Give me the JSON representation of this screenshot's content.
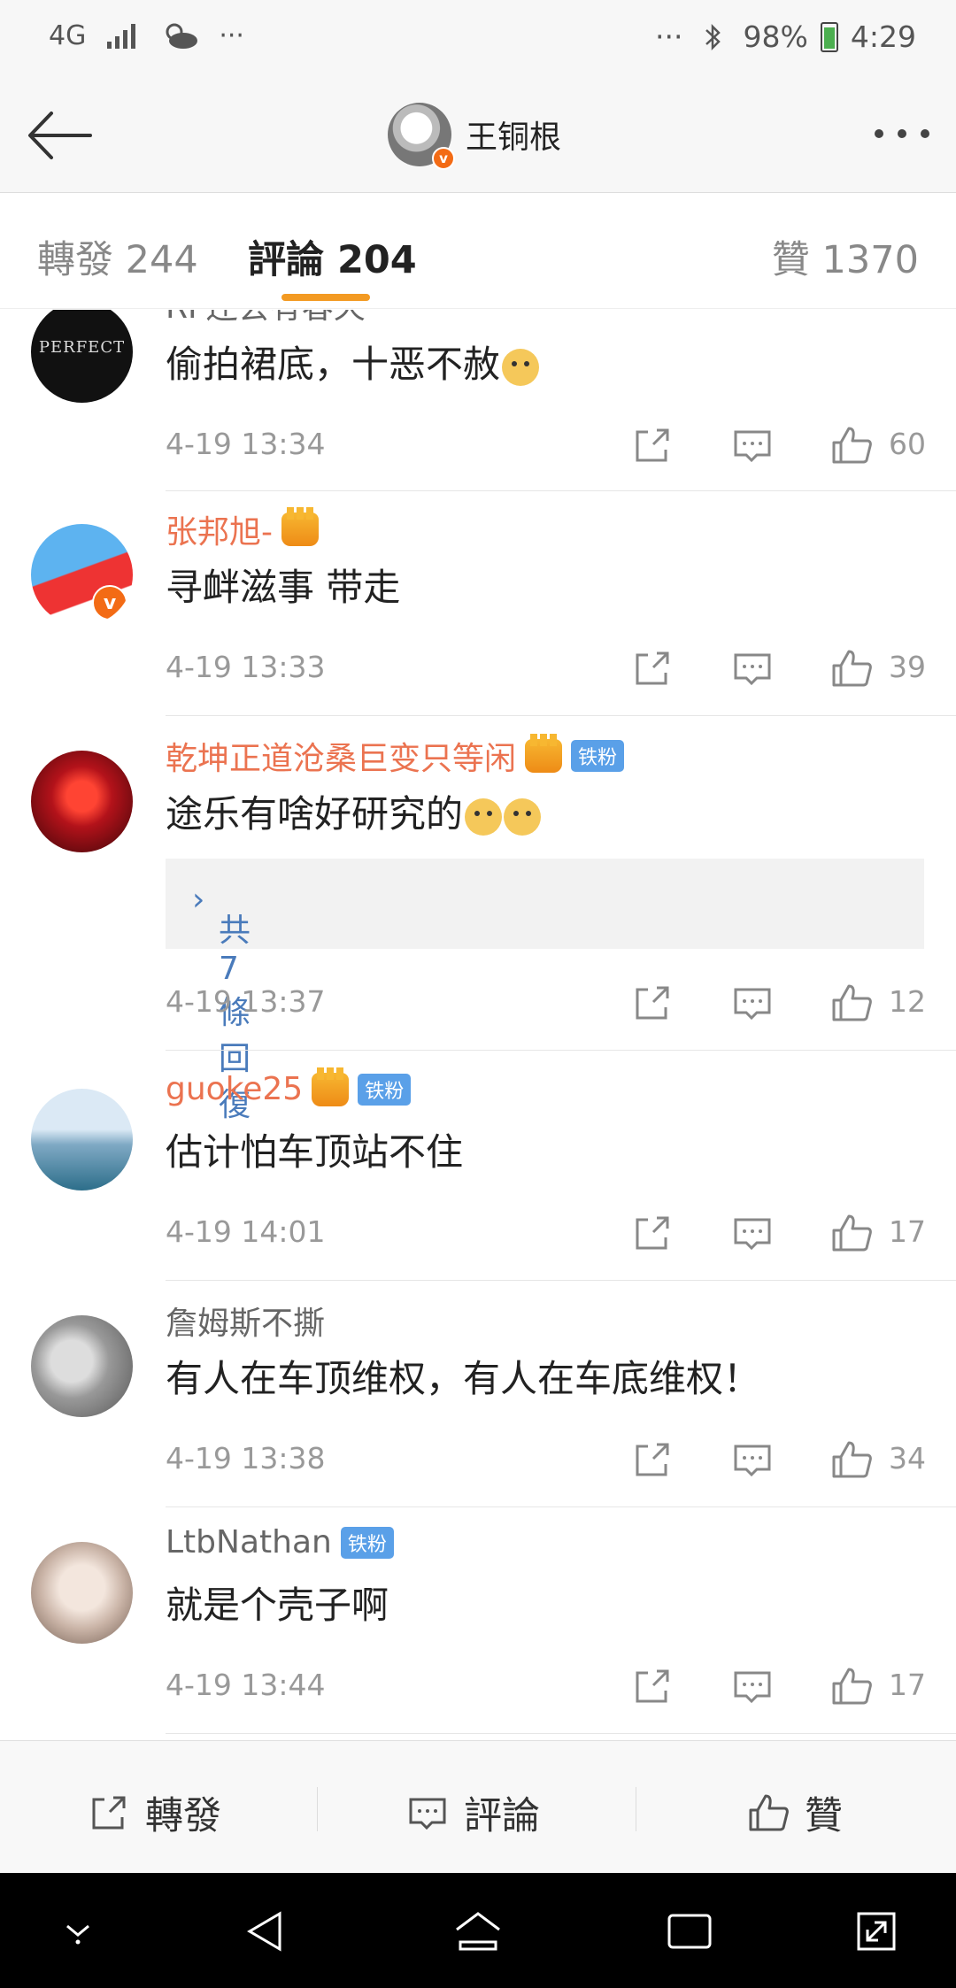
{
  "status": {
    "network": "4G",
    "battery": "98%",
    "time": "4:29"
  },
  "header": {
    "title": "王铜根"
  },
  "tabs": [
    {
      "label": "轉發 244"
    },
    {
      "label": "評論 204"
    },
    {
      "label": "贊 1370"
    }
  ],
  "comments": [
    {
      "user": "RF还会有春天",
      "text": "偷拍裙底，十恶不赦",
      "time": "4-19 13:34",
      "likes": "60"
    },
    {
      "user": "张邦旭-",
      "text": "寻衅滋事 带走",
      "time": "4-19 13:33",
      "likes": "39"
    },
    {
      "user": "乾坤正道沧桑巨变只等闲",
      "badge": "铁粉",
      "text": "途乐有啥好研究的",
      "replies": "共7條回復",
      "time": "4-19 13:37",
      "likes": "12"
    },
    {
      "user": "guoke25",
      "badge": "铁粉",
      "text": "估计怕车顶站不住",
      "time": "4-19 14:01",
      "likes": "17"
    },
    {
      "user": "詹姆斯不撕",
      "text": "有人在车顶维权，有人在车底维权！",
      "time": "4-19 13:38",
      "likes": "34"
    },
    {
      "user": "LtbNathan",
      "badge": "铁粉",
      "text": "就是个壳子啊",
      "time": "4-19 13:44",
      "likes": "17"
    }
  ],
  "avatar_text": "PERFECT",
  "toolbar": {
    "repost": "轉發",
    "comment": "評論",
    "like": "贊"
  },
  "colors": {
    "accent": "#f39a22",
    "vip_name": "#eb7350",
    "link": "#4a7bbb",
    "fan_badge": "#5aa0e8"
  }
}
